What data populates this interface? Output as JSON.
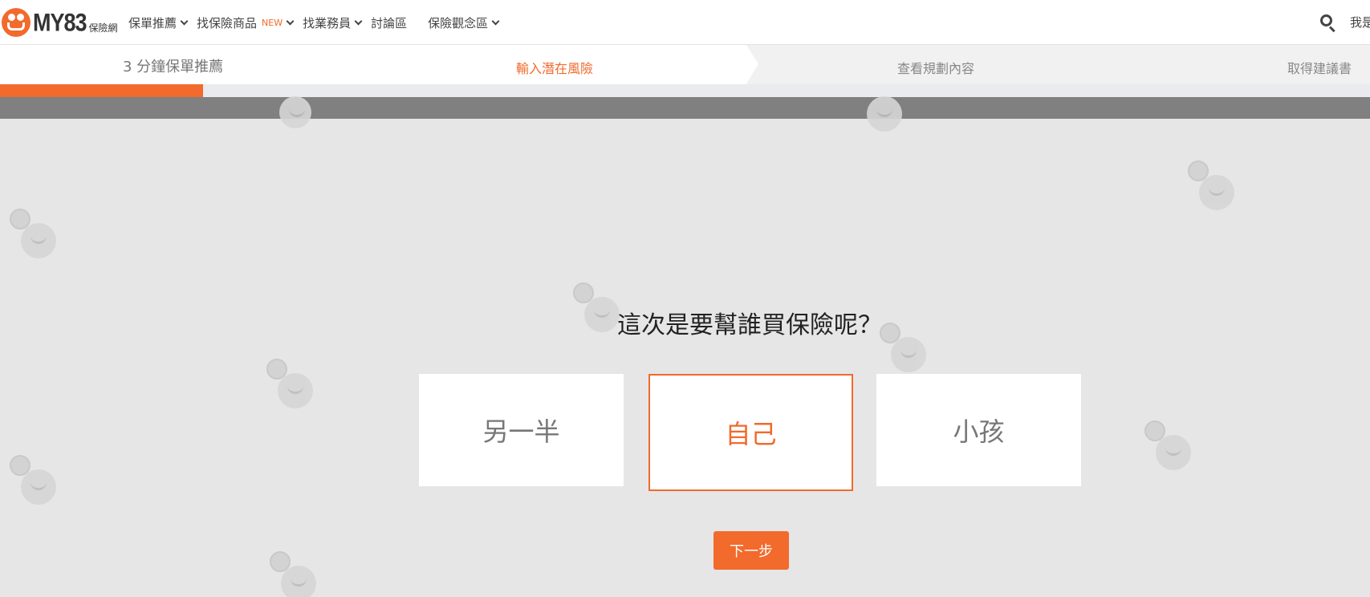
{
  "brand": {
    "logo_text": "MY83",
    "logo_sub": "保險網"
  },
  "nav": {
    "items": [
      {
        "label": "保單推薦",
        "has_dropdown": true
      },
      {
        "label": "找保險商品",
        "badge": "NEW",
        "has_dropdown": true
      },
      {
        "label": "找業務員",
        "has_dropdown": true
      },
      {
        "label": "討論區",
        "has_dropdown": false
      },
      {
        "label": "保險觀念區",
        "has_dropdown": true
      }
    ],
    "right_label": "我是",
    "search_icon": "search-icon"
  },
  "steps": {
    "brand_title": "3 分鐘保單推薦",
    "items": [
      "輸入潛在風險",
      "查看規劃內容",
      "取得建議書"
    ],
    "active_index": 0
  },
  "progress": {
    "fraction": 0.148
  },
  "question": {
    "text": "這次是要幫誰買保險呢？",
    "options": [
      "另一半",
      "自己",
      "小孩"
    ],
    "selected_index": 1
  },
  "actions": {
    "next_label": "下一步"
  },
  "colors": {
    "accent": "#f26a2c",
    "background": "#e6e6e6",
    "band": "#808080"
  }
}
